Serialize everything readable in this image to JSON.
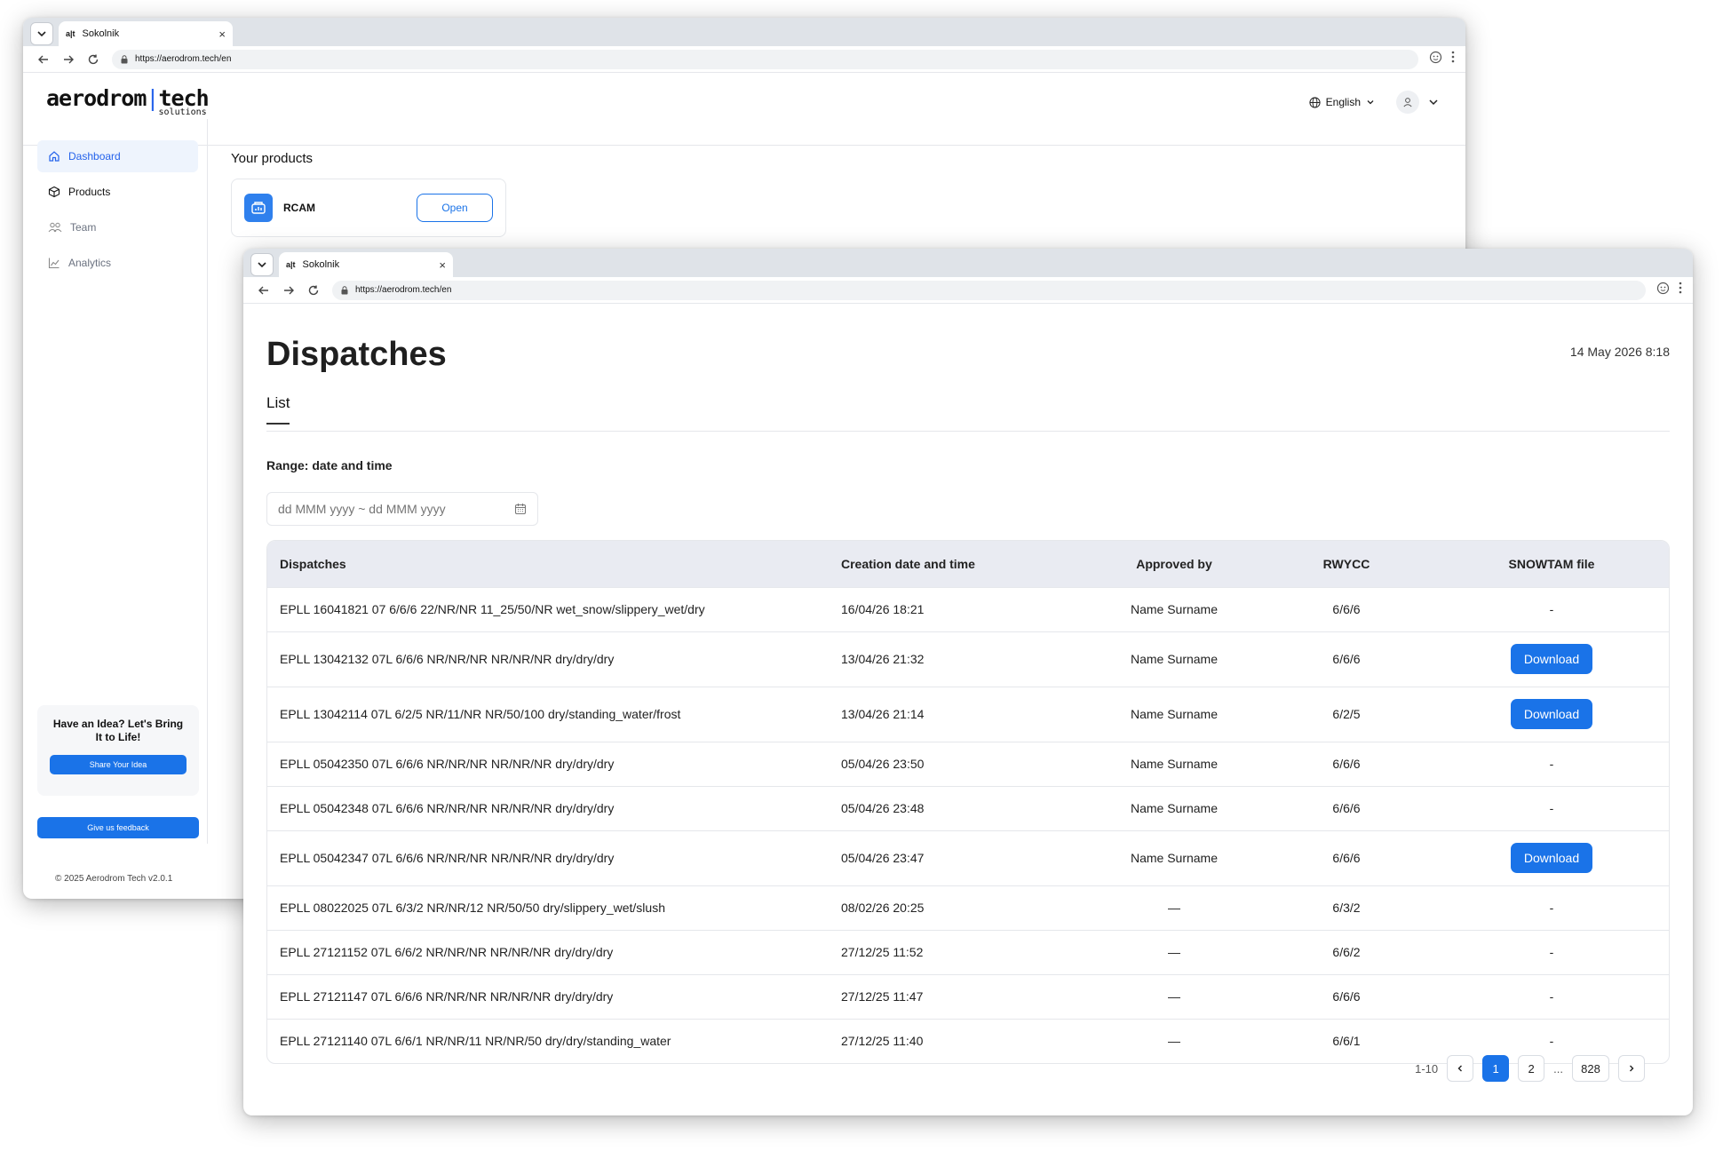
{
  "back_window": {
    "tab_title": "Sokolnik",
    "favicon_text": "a|t",
    "url": "https://aerodrom.tech/en",
    "logo_main_a": "aerodrom",
    "logo_bar": "|",
    "logo_main_b": "tech",
    "logo_sub": "solutions",
    "language": "English",
    "nav": [
      {
        "label": "Dashboard",
        "icon": "home-icon"
      },
      {
        "label": "Products",
        "icon": "cube-icon"
      },
      {
        "label": "Team",
        "icon": "users-icon"
      },
      {
        "label": "Analytics",
        "icon": "chart-icon"
      }
    ],
    "idea_title": "Have an Idea? Let's Bring It to Life!",
    "idea_button": "Share Your Idea",
    "feedback_button": "Give us feedback",
    "copyright": "© 2025 Aerodrom Tech v2.0.1",
    "products_heading": "Your products",
    "product": {
      "name": "RCAM",
      "open_label": "Open"
    }
  },
  "front_window": {
    "tab_title": "Sokolnik",
    "favicon_text": "a|t",
    "url": "https://aerodrom.tech/en",
    "title": "Dispatches",
    "datetime": "14 May 2026 8:18",
    "tab_list": "List",
    "range_label": "Range: date and time",
    "date_placeholder": "dd MMM yyyy ~ dd MMM yyyy",
    "table": {
      "headers": [
        "Dispatches",
        "Creation date and time",
        "Approved by",
        "RWYCC",
        "SNOWTAM file"
      ],
      "rows": [
        {
          "dispatch": "EPLL 16041821 07 6/6/6 22/NR/NR 11_25/50/NR wet_snow/slippery_wet/dry",
          "created": "16/04/26 18:21",
          "approved": "Name Surname",
          "rwycc": "6/6/6",
          "file": "-"
        },
        {
          "dispatch": "EPLL 13042132 07L 6/6/6 NR/NR/NR NR/NR/NR dry/dry/dry",
          "created": "13/04/26 21:32",
          "approved": "Name Surname",
          "rwycc": "6/6/6",
          "file": "Download"
        },
        {
          "dispatch": "EPLL 13042114 07L 6/2/5 NR/11/NR NR/50/100 dry/standing_water/frost",
          "created": "13/04/26 21:14",
          "approved": "Name Surname",
          "rwycc": "6/2/5",
          "file": "Download"
        },
        {
          "dispatch": "EPLL 05042350 07L 6/6/6 NR/NR/NR NR/NR/NR dry/dry/dry",
          "created": "05/04/26 23:50",
          "approved": "Name Surname",
          "rwycc": "6/6/6",
          "file": "-"
        },
        {
          "dispatch": "EPLL 05042348 07L 6/6/6 NR/NR/NR NR/NR/NR dry/dry/dry",
          "created": "05/04/26 23:48",
          "approved": "Name Surname",
          "rwycc": "6/6/6",
          "file": "-"
        },
        {
          "dispatch": "EPLL 05042347 07L 6/6/6 NR/NR/NR NR/NR/NR dry/dry/dry",
          "created": "05/04/26 23:47",
          "approved": "Name Surname",
          "rwycc": "6/6/6",
          "file": "Download"
        },
        {
          "dispatch": "EPLL 08022025 07L 6/3/2 NR/NR/12 NR/50/50 dry/slippery_wet/slush",
          "created": "08/02/26 20:25",
          "approved": "—",
          "rwycc": "6/3/2",
          "file": "-"
        },
        {
          "dispatch": "EPLL 27121152 07L 6/6/2 NR/NR/NR NR/NR/NR dry/dry/dry",
          "created": "27/12/25 11:52",
          "approved": "—",
          "rwycc": "6/6/2",
          "file": "-"
        },
        {
          "dispatch": "EPLL 27121147 07L 6/6/6 NR/NR/NR NR/NR/NR dry/dry/dry",
          "created": "27/12/25 11:47",
          "approved": "—",
          "rwycc": "6/6/6",
          "file": "-"
        },
        {
          "dispatch": "EPLL 27121140 07L 6/6/1 NR/NR/11 NR/NR/50 dry/dry/standing_water",
          "created": "27/12/25 11:40",
          "approved": "—",
          "rwycc": "6/6/1",
          "file": "-"
        }
      ]
    },
    "pagination": {
      "range": "1-10",
      "pages": [
        "1",
        "2"
      ],
      "ellipsis": "...",
      "last": "828",
      "current": "1"
    }
  },
  "colors": {
    "accent": "#1a73e8",
    "header_bg": "#e9ebf2",
    "active_nav_bg": "#eef4fd"
  }
}
